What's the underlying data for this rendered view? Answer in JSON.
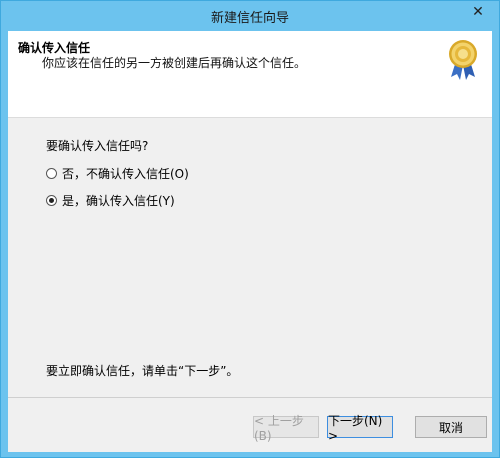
{
  "window": {
    "title": "新建信任向导",
    "close_glyph": "✕"
  },
  "header": {
    "title": "确认传入信任",
    "subtitle": "你应该在信任的另一方被创建后再确认这个信任。",
    "icon": "certificate-award-icon"
  },
  "body": {
    "question": "要确认传入信任吗?",
    "options": [
      {
        "label": "否，不确认传入信任(O)",
        "checked": false
      },
      {
        "label": "是，确认传入信任(Y)",
        "checked": true
      }
    ],
    "hint": "要立即确认信任，请单击“下一步”。"
  },
  "buttons": {
    "back": "< 上一步(B)",
    "next": "下一步(N) >",
    "cancel": "取消"
  },
  "colors": {
    "frame": "#6cc3ee",
    "client": "#f0f0f0",
    "default_button_border": "#3d8ee0"
  }
}
